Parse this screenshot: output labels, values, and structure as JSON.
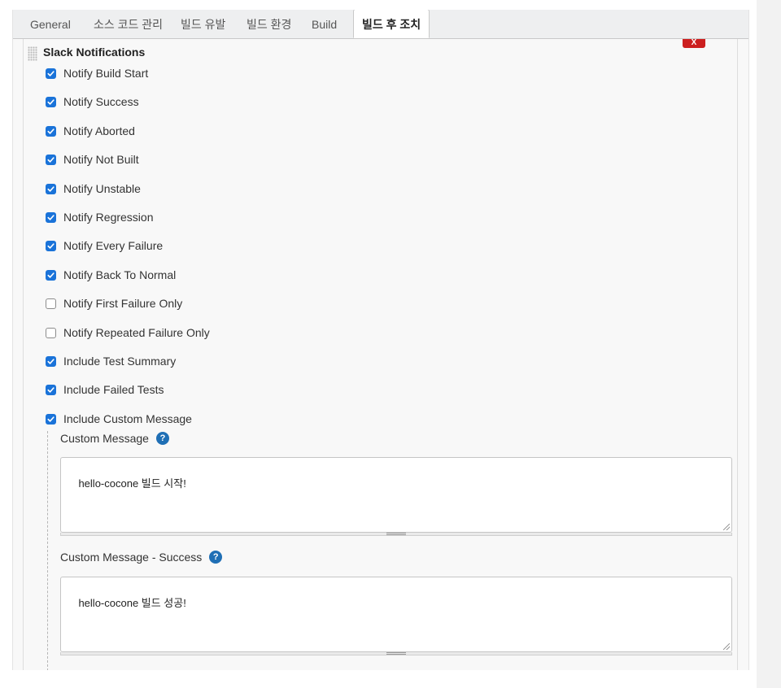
{
  "tabs": [
    {
      "label": "General",
      "active": false
    },
    {
      "label": "소스 코드 관리",
      "active": false
    },
    {
      "label": "빌드 유발",
      "active": false
    },
    {
      "label": "빌드 환경",
      "active": false
    },
    {
      "label": "Build",
      "active": false
    },
    {
      "label": "빌드 후 조치",
      "active": true
    }
  ],
  "section": {
    "title": "Slack Notifications",
    "delete_label": "X"
  },
  "options": [
    {
      "label": "Notify Build Start",
      "checked": true
    },
    {
      "label": "Notify Success",
      "checked": true
    },
    {
      "label": "Notify Aborted",
      "checked": true
    },
    {
      "label": "Notify Not Built",
      "checked": true
    },
    {
      "label": "Notify Unstable",
      "checked": true
    },
    {
      "label": "Notify Regression",
      "checked": true
    },
    {
      "label": "Notify Every Failure",
      "checked": true
    },
    {
      "label": "Notify Back To Normal",
      "checked": true
    },
    {
      "label": "Notify First Failure Only",
      "checked": false
    },
    {
      "label": "Notify Repeated Failure Only",
      "checked": false
    },
    {
      "label": "Include Test Summary",
      "checked": true
    },
    {
      "label": "Include Failed Tests",
      "checked": true
    },
    {
      "label": "Include Custom Message",
      "checked": true
    }
  ],
  "custom_message": {
    "label": "Custom Message",
    "help": "?",
    "value": "hello-cocone 빌드 시작!"
  },
  "custom_message_success": {
    "label": "Custom Message - Success",
    "help": "?",
    "value": "hello-cocone 빌드 성공!"
  },
  "colors": {
    "checkbox_checked": "#1a73d9",
    "delete_button": "#cc1f1f",
    "help_icon": "#1f6fb5"
  }
}
